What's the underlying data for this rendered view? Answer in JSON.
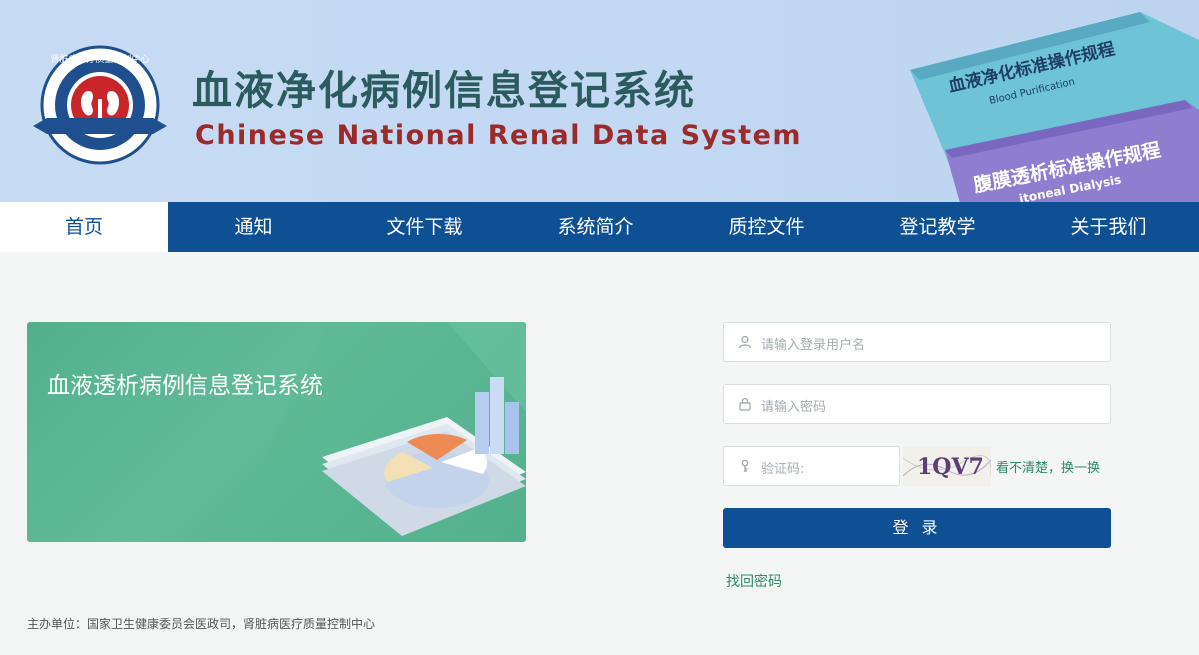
{
  "header": {
    "logo_ring_text": "肾脏病医疗质量控制中心",
    "title_cn": "血液净化病例信息登记系统",
    "title_en": "Chinese National Renal Data System",
    "book1_title": "血液净化标准操作规程",
    "book1_sub": "Blood Purification",
    "book2_title": "腹膜透析标准操作规程",
    "book2_sub": "itoneal Dialysis"
  },
  "nav": {
    "items": [
      "首页",
      "通知",
      "文件下载",
      "系统简介",
      "质控文件",
      "登记教学",
      "关于我们"
    ],
    "active_index": 0
  },
  "banner": {
    "title": "血液透析病例信息登记系统"
  },
  "login": {
    "username_placeholder": "请输入登录用户名",
    "password_placeholder": "请输入密码",
    "captcha_placeholder": "验证码:",
    "captcha_text": "1QV7",
    "captcha_refresh": "看不清楚，换一换",
    "submit_label": "登 录",
    "forgot_label": "找回密码"
  },
  "footer": {
    "text": "主办单位：国家卫生健康委员会医政司，肾脏病医疗质量控制中心"
  },
  "colors": {
    "nav_bg": "#0f4f94",
    "banner_green": "#52b08d",
    "link_green": "#2e8b66",
    "title_teal": "#2b5b5e",
    "title_red": "#9b2b2b"
  }
}
